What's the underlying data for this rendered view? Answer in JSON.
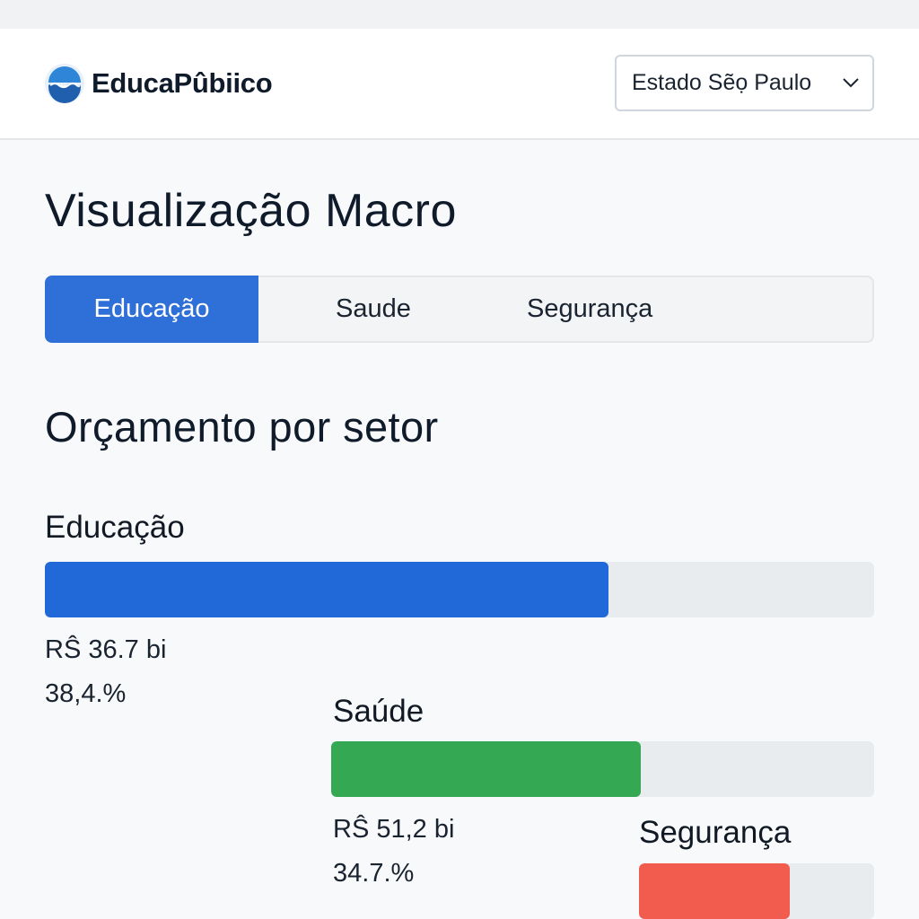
{
  "header": {
    "brand": "EducaPûbiico",
    "state_select": "Estado Sẽọ Paulo"
  },
  "page_title": "Visualização Macro",
  "tabs": [
    {
      "label": "Educação",
      "active": true
    },
    {
      "label": "Saude",
      "active": false
    },
    {
      "label": "Segurança",
      "active": false
    }
  ],
  "section_title": "Orçamento por setor",
  "sectors": [
    {
      "name": "Educação",
      "amount": "RŜ 36.7 bi",
      "percent": "38,4.%",
      "fill_fraction": 0.68,
      "color": "#2169d8"
    },
    {
      "name": "Saúde",
      "amount": "RŜ 51,2 bi",
      "percent": "34.7.%",
      "fill_fraction": 0.57,
      "color": "#34a853"
    },
    {
      "name": "Segurança",
      "fill_fraction": 0.64,
      "color": "#f25c4f"
    }
  ],
  "icons": {
    "logo": "wave-logo-icon",
    "select_arrow": "chevron-down-icon"
  }
}
